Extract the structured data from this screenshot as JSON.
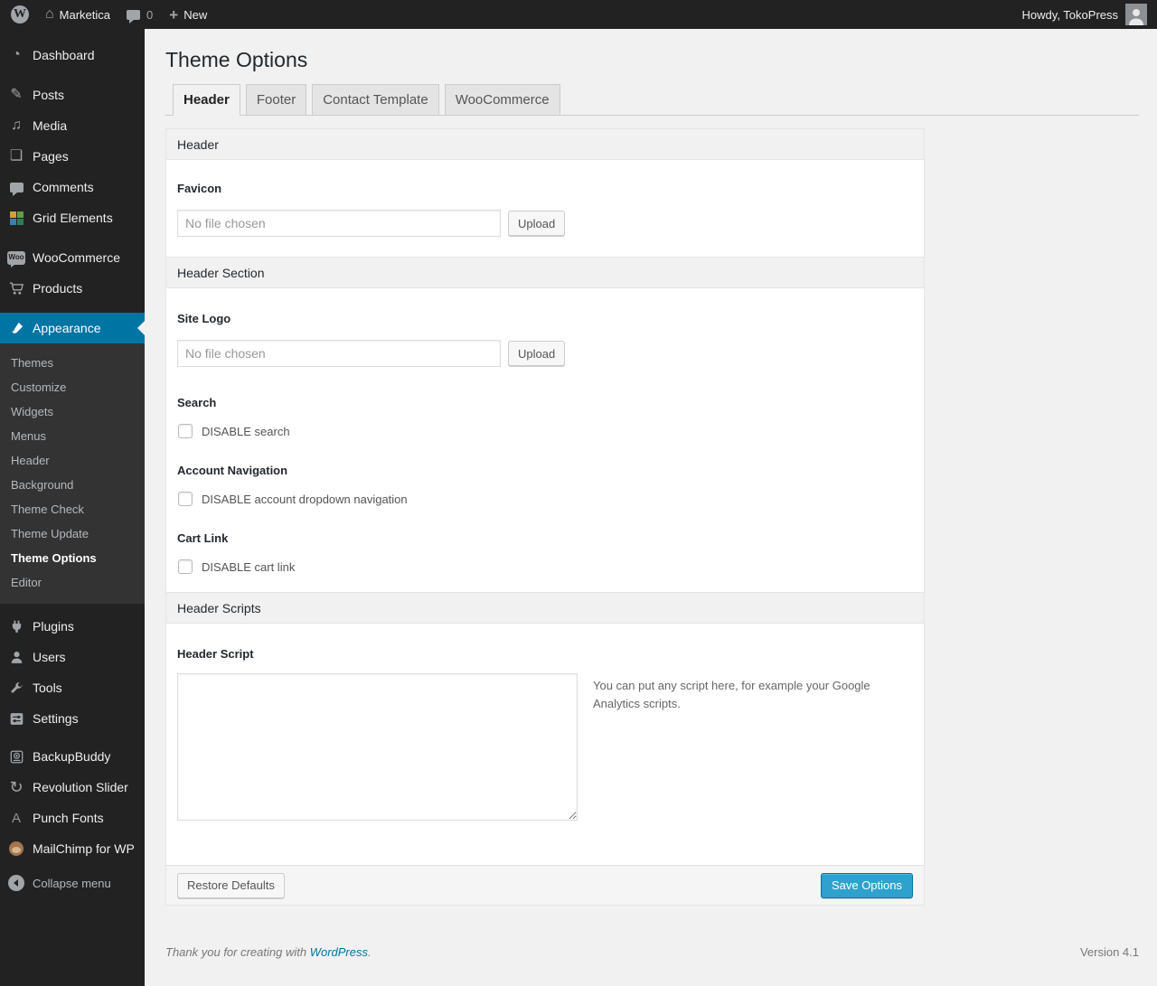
{
  "admin_bar": {
    "site_name": "Marketica",
    "comment_count": "0",
    "new_label": "New",
    "howdy": "Howdy, TokoPress"
  },
  "sidebar": {
    "items": [
      {
        "label": "Dashboard"
      },
      {
        "label": "Posts"
      },
      {
        "label": "Media"
      },
      {
        "label": "Pages"
      },
      {
        "label": "Comments"
      },
      {
        "label": "Grid Elements"
      },
      {
        "label": "WooCommerce"
      },
      {
        "label": "Products"
      },
      {
        "label": "Appearance",
        "active": true
      },
      {
        "label": "Plugins"
      },
      {
        "label": "Users"
      },
      {
        "label": "Tools"
      },
      {
        "label": "Settings"
      },
      {
        "label": "BackupBuddy"
      },
      {
        "label": "Revolution Slider"
      },
      {
        "label": "Punch Fonts"
      },
      {
        "label": "MailChimp for WP"
      }
    ],
    "submenu": [
      "Themes",
      "Customize",
      "Widgets",
      "Menus",
      "Header",
      "Background",
      "Theme Check",
      "Theme Update",
      "Theme Options",
      "Editor"
    ],
    "submenu_active": "Theme Options",
    "collapse_label": "Collapse menu"
  },
  "page": {
    "title": "Theme Options",
    "tabs": [
      {
        "label": "Header",
        "active": true
      },
      {
        "label": "Footer",
        "active": false
      },
      {
        "label": "Contact Template",
        "active": false
      },
      {
        "label": "WooCommerce",
        "active": false
      }
    ]
  },
  "panel": {
    "section1_title": "Header",
    "favicon_label": "Favicon",
    "file_placeholder": "No file chosen",
    "favicon_file_value": "",
    "upload_label": "Upload",
    "section2_title": "Header Section",
    "site_logo_label": "Site Logo",
    "site_logo_file_value": "",
    "search_label": "Search",
    "disable_search_label": "DISABLE search",
    "disable_search_checked": false,
    "account_nav_label": "Account Navigation",
    "disable_account_label": "DISABLE account dropdown navigation",
    "disable_account_checked": false,
    "cart_link_label": "Cart Link",
    "disable_cart_label": "DISABLE cart link",
    "disable_cart_checked": false,
    "section3_title": "Header Scripts",
    "header_script_label": "Header Script",
    "header_script_value": "",
    "script_help": "You can put any script here, for example your Google Analytics scripts.",
    "restore_label": "Restore Defaults",
    "save_label": "Save Options"
  },
  "footer": {
    "thanks_prefix": "Thank you for creating with ",
    "thanks_link": "WordPress",
    "thanks_suffix": ".",
    "version": "Version 4.1"
  },
  "colors": {
    "accent": "#0074a2",
    "button_primary": "#2ea2cc",
    "menu_bg": "#222222",
    "submenu_bg": "#333333"
  }
}
